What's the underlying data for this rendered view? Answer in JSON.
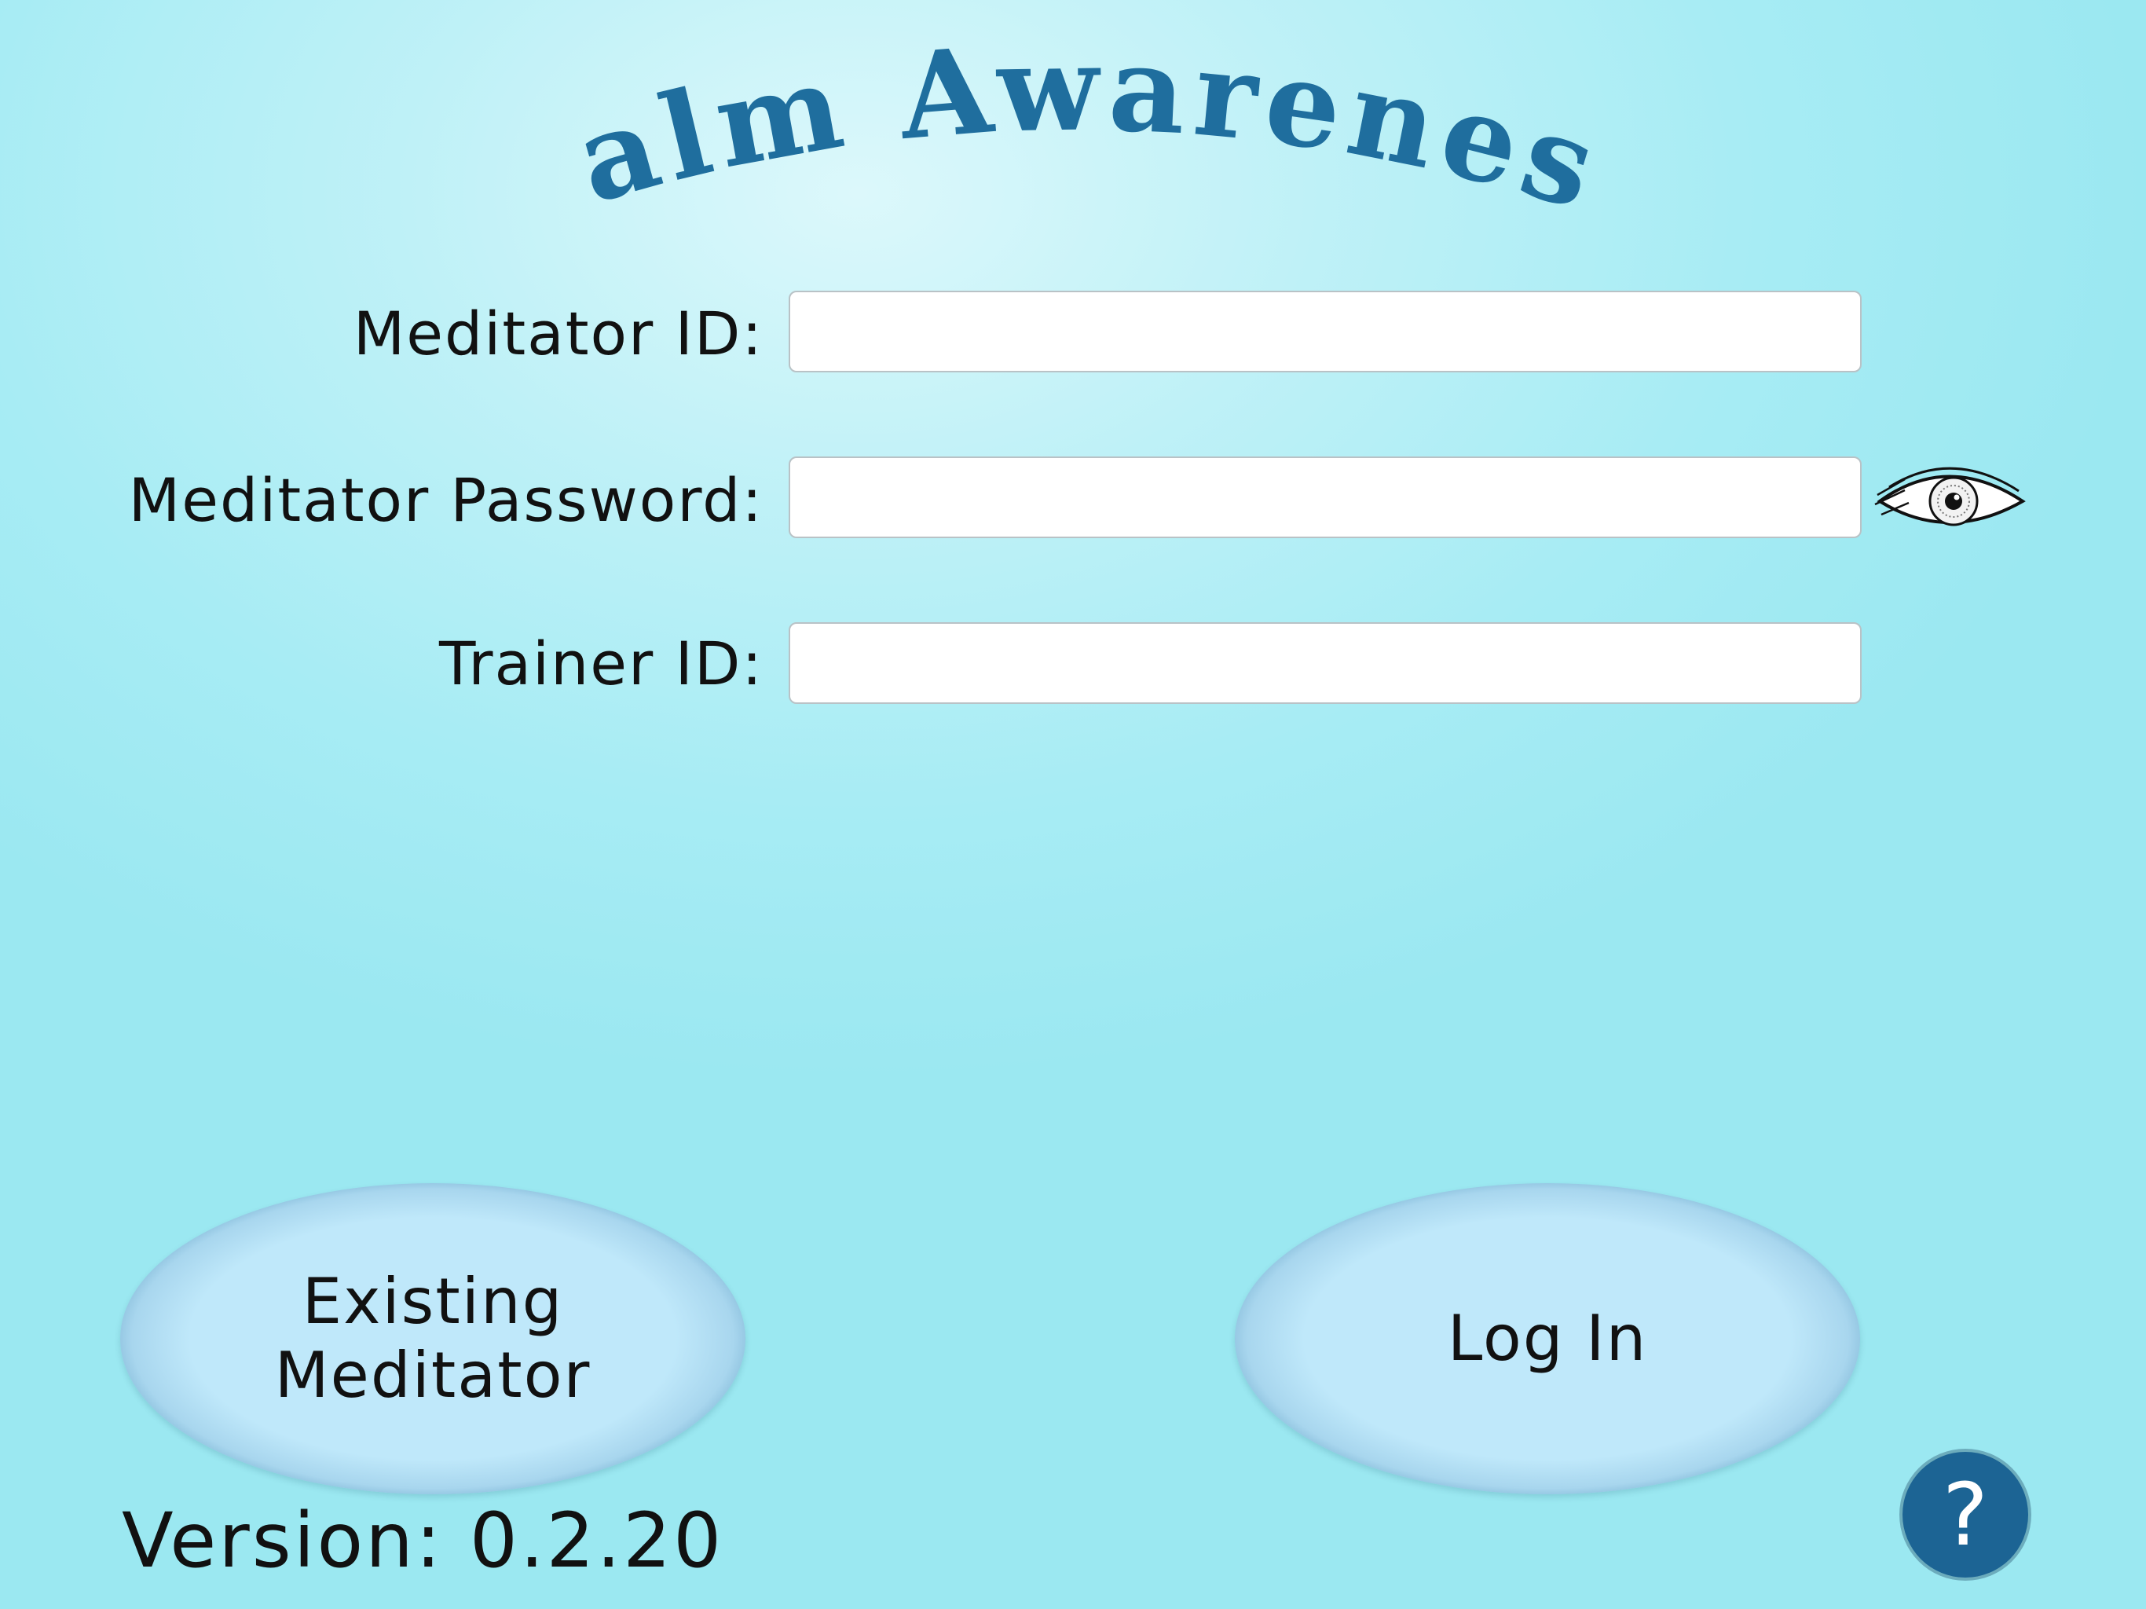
{
  "app": {
    "title": "Calm Awareness"
  },
  "form": {
    "meditator_id": {
      "label": "Meditator ID:",
      "value": "",
      "placeholder": ""
    },
    "meditator_password": {
      "label": "Meditator Password:",
      "value": "",
      "placeholder": ""
    },
    "trainer_id": {
      "label": "Trainer ID:",
      "value": "",
      "placeholder": ""
    }
  },
  "buttons": {
    "existing_meditator": "Existing\nMeditator",
    "log_in": "Log In",
    "help": "?"
  },
  "footer": {
    "version": "Version: 0.2.20"
  },
  "icons": {
    "show_password": "eye-icon",
    "help": "question-mark-icon"
  },
  "colors": {
    "title": "#1f6e9e",
    "button_ring": "#236898",
    "button_fill": "#bfe8fa",
    "help_bg": "#1c6494"
  }
}
